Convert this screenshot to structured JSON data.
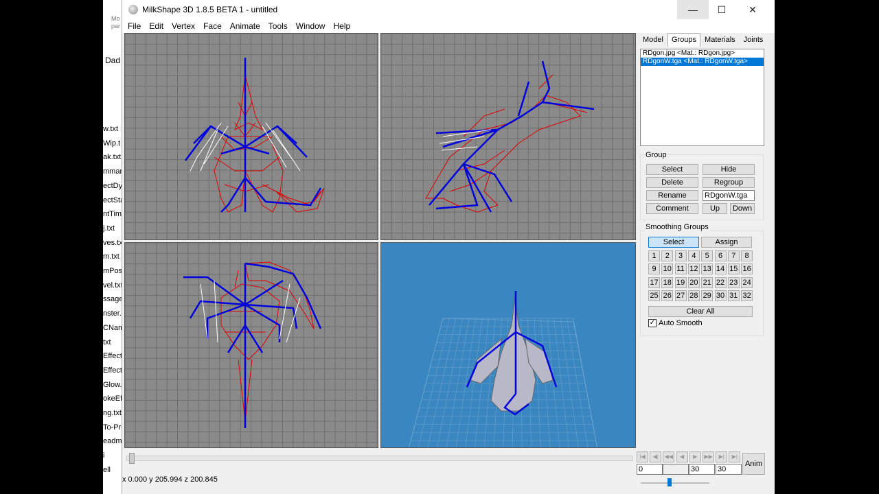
{
  "explorer": {
    "header": "Mo\npar",
    "folder": "Dad",
    "files": [
      "w.txt",
      "Wip.t",
      "ak.txt",
      "mmar",
      "ectDy",
      "ectSta",
      "ntTim",
      "j.txt",
      "ves.tx",
      "m.txt",
      "mPosi",
      "vel.txt",
      "ssage",
      "nster.",
      "CNam",
      "txt",
      "Effect",
      "Effect",
      "Glow.",
      "okeEf",
      "ng.txt",
      "To-Pre",
      "eadm",
      "i",
      "ell"
    ]
  },
  "window": {
    "title": "MilkShape 3D 1.8.5 BETA 1 - untitled",
    "controls": {
      "minimize": "—",
      "maximize": "☐",
      "close": "✕"
    }
  },
  "menu": [
    "File",
    "Edit",
    "Vertex",
    "Face",
    "Animate",
    "Tools",
    "Window",
    "Help"
  ],
  "panel": {
    "tabs": [
      "Model",
      "Groups",
      "Materials",
      "Joints"
    ],
    "active_tab": "Groups",
    "groups_list": [
      {
        "label": "RDgon.jpg <Mat.: RDgon.jpg>",
        "selected": false
      },
      {
        "label": "RDgonW.tga <Mat.: RDgonW.tga>",
        "selected": true
      }
    ],
    "group_section": {
      "title": "Group",
      "select": "Select",
      "hide": "Hide",
      "delete": "Delete",
      "regroup": "Regroup",
      "rename": "Rename",
      "name_value": "RDgonW.tga",
      "comment": "Comment",
      "up": "Up",
      "down": "Down"
    },
    "smoothing": {
      "title": "Smoothing Groups",
      "select": "Select",
      "assign": "Assign",
      "numbers": [
        "1",
        "2",
        "3",
        "4",
        "5",
        "6",
        "7",
        "8",
        "9",
        "10",
        "11",
        "12",
        "13",
        "14",
        "15",
        "16",
        "17",
        "18",
        "19",
        "20",
        "21",
        "22",
        "23",
        "24",
        "25",
        "26",
        "27",
        "28",
        "29",
        "30",
        "31",
        "32"
      ],
      "clear_all": "Clear All",
      "auto_smooth": "Auto Smooth",
      "auto_smooth_checked": true
    }
  },
  "timeline": {
    "frame_start": "0",
    "frame_current": "30",
    "frame_end": "30",
    "anim_label": "Anim",
    "playback": [
      "|◀",
      "◀|",
      "◀◀",
      "◀",
      "▶",
      "▶▶",
      "▶|",
      "▶|"
    ]
  },
  "status": {
    "coords": "x 0.000 y 205.994 z 200.845"
  },
  "colors": {
    "viewport_bg": "#8a8a8a",
    "grid": "#6e6e6e",
    "mesh": "#e00000",
    "bones": "#0000dd",
    "perspective_bg": "#3a86c0",
    "selection": "#0078d7"
  }
}
